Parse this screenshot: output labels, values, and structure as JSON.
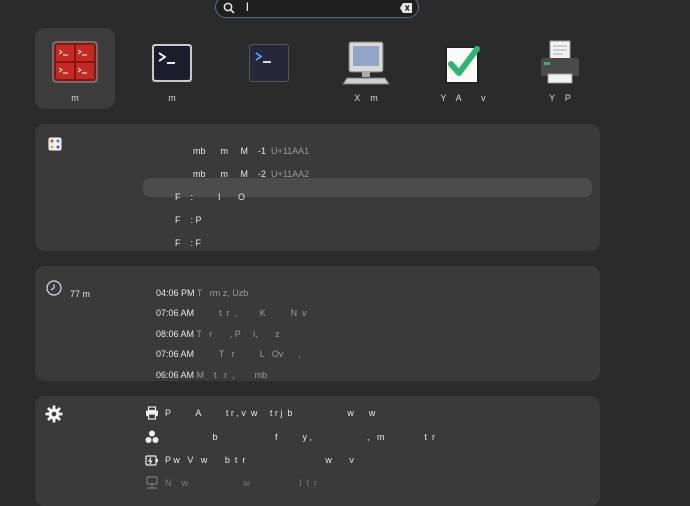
{
  "search": {
    "value": "l",
    "placeholder": ""
  },
  "apps": [
    {
      "label": "m"
    },
    {
      "label": "m"
    },
    {
      "label": ""
    },
    {
      "label": "X    m"
    },
    {
      "label": "Y    A        v"
    },
    {
      "label": "Y    P"
    }
  ],
  "characters": {
    "rows": [
      {
        "name": "mb      m     M    -1",
        "code": "U+11AA1"
      },
      {
        "name": "mb      m     M    -2",
        "code": "U+11AA2"
      },
      {
        "name": "F    :          I       O",
        "code": ""
      },
      {
        "name": "F    : P",
        "code": ""
      },
      {
        "name": "F    : F",
        "code": ""
      }
    ]
  },
  "clocks": {
    "label": "77 m",
    "rows": [
      {
        "time": "04:06 PM",
        "place": "T   rm z, Uzb"
      },
      {
        "time": "07:06 AM",
        "place": "         t  r  ,         K          N  v"
      },
      {
        "time": "08:06 AM",
        "place": "T   r       , P     i,       z"
      },
      {
        "time": "07:06 AM",
        "place": "         T   r          L   Ov      ,"
      },
      {
        "time": "06:06 AM",
        "place": "M    t   r  ,        mb"
      }
    ]
  },
  "settings": {
    "rows": [
      {
        "text": "P          A          t r , v  w     t r j  b                      w      w"
      },
      {
        "text": "                   b                       f          y ,                      ,   m                t  r"
      },
      {
        "text": "P w   V   w       b  t  r                                w       v"
      },
      {
        "text": "N    w                      w                    l  t  r"
      }
    ]
  },
  "colors": {
    "accent_check": "#2bb673",
    "terminal_red": "#b3211b"
  }
}
